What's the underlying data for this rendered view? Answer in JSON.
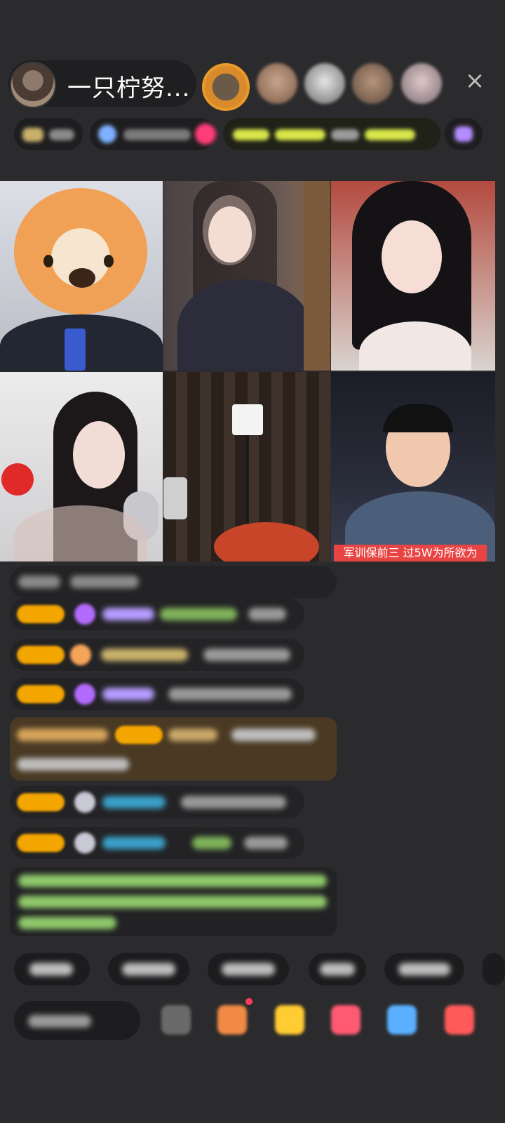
{
  "header": {
    "host_name": "一只柠努...",
    "close_icon": "×"
  },
  "video_grid": {
    "tiles": [
      {
        "id": 1,
        "subject": "shiba-dog-avatar"
      },
      {
        "id": 2,
        "subject": "woman-long-hair-sequin-dress"
      },
      {
        "id": 3,
        "subject": "woman-black-hair-red-room"
      },
      {
        "id": 4,
        "subject": "woman-with-microphone"
      },
      {
        "id": 5,
        "subject": "curtains-lamp-empty"
      },
      {
        "id": 6,
        "subject": "man-city-night"
      }
    ],
    "banner_text": "军训保前三 过5W为所欲为"
  },
  "colors": {
    "background": "#2b2b2d",
    "badge": "#f3a500",
    "banner": "#e84444",
    "notice_text": "#8fc86a",
    "blue_username": "#3aa0c8",
    "purple_username": "#b69cff"
  }
}
